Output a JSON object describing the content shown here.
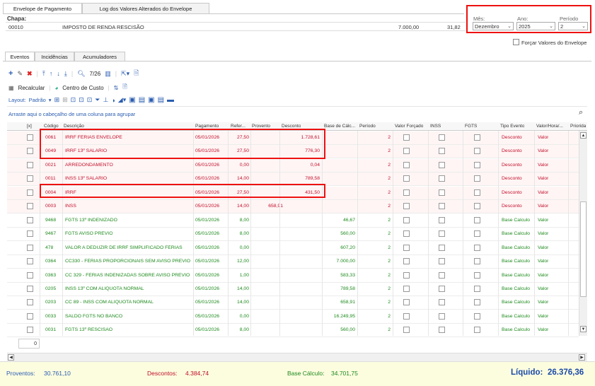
{
  "tabs": [
    "Envelope de Pagamento",
    "Log dos Valores Alterados do Envelope"
  ],
  "chapa": {
    "label": "Chapa:",
    "value": "00010",
    "desc": "IMPOSTO DE RENDA RESCISÃO",
    "num1": "7.000,00",
    "num2": "31,82"
  },
  "period": {
    "mes_label": "Mês:",
    "mes_value": "Dezembro",
    "ano_label": "Ano:",
    "ano_value": "2025",
    "periodo_label": "Período",
    "periodo_value": "2"
  },
  "forcar_label": "Forçar Valores do Envelope",
  "subtabs": [
    "Eventos",
    "Incidências",
    "Acumuladores"
  ],
  "toolbar": {
    "counter": "7/26",
    "recalcular": "Recalcular",
    "centro": "Centro de Custo",
    "layout": "Layout:",
    "padrao": "Padrão"
  },
  "group_hint": "Arraste aqui o cabeçalho de uma coluna para agrupar",
  "columns": [
    "[x]",
    "Código",
    "Descrição",
    "Pagamento",
    "Refer...",
    "Provento",
    "Desconto",
    "Base de Cálc...",
    "Período",
    "Valor Forçado",
    "INSS",
    "FGTS",
    "Tipo Evento",
    "Valor/Hora/...",
    "Priorida"
  ],
  "rows": [
    {
      "cod": "0061",
      "desc": "IRRF FÉRIAS ENVELOPE",
      "pag": "05/01/2026",
      "ref": "27,50",
      "prov": "",
      "desc_val": "1.728,61",
      "base": "",
      "per": "2",
      "tipo": "Desconto",
      "vh": "Valor",
      "kind": "red"
    },
    {
      "cod": "0049",
      "desc": "IRRF 13º SALARIO",
      "pag": "05/01/2026",
      "ref": "27,50",
      "prov": "",
      "desc_val": "776,30",
      "base": "",
      "per": "2",
      "tipo": "Desconto",
      "vh": "Valor",
      "kind": "red"
    },
    {
      "cod": "0021",
      "desc": "ARREDONDAMENTO",
      "pag": "05/01/2026",
      "ref": "0,00",
      "prov": "",
      "desc_val": "0,04",
      "base": "",
      "per": "2",
      "tipo": "Desconto",
      "vh": "Valor",
      "kind": "red"
    },
    {
      "cod": "0011",
      "desc": "INSS 13º SALARIO",
      "pag": "05/01/2026",
      "ref": "14,00",
      "prov": "",
      "desc_val": "789,58",
      "base": "",
      "per": "2",
      "tipo": "Desconto",
      "vh": "Valor",
      "kind": "red"
    },
    {
      "cod": "0004",
      "desc": "IRRF",
      "pag": "05/01/2026",
      "ref": "27,50",
      "prov": "",
      "desc_val": "431,50",
      "base": "",
      "per": "2",
      "tipo": "Desconto",
      "vh": "Valor",
      "kind": "red"
    },
    {
      "cod": "0003",
      "desc": "INSS",
      "pag": "05/01/2026",
      "ref": "14,00",
      "prov": "658,91",
      "desc_val": "",
      "base": "",
      "per": "2",
      "tipo": "Desconto",
      "vh": "Valor",
      "kind": "red"
    },
    {
      "cod": "9468",
      "desc": "FGTS 13º INDENIZADO",
      "pag": "05/01/2026",
      "ref": "8,00",
      "prov": "",
      "desc_val": "",
      "base": "46,67",
      "per": "2",
      "tipo": "Base Calculo",
      "vh": "Valor",
      "kind": "green"
    },
    {
      "cod": "9467",
      "desc": "FGTS AVISO PRÉVIO",
      "pag": "05/01/2026",
      "ref": "8,00",
      "prov": "",
      "desc_val": "",
      "base": "560,00",
      "per": "2",
      "tipo": "Base Calculo",
      "vh": "Valor",
      "kind": "green"
    },
    {
      "cod": "478",
      "desc": "VALOR A DEDUZIR DE IRRF SIMPLIFICADO FÉRIAS",
      "pag": "05/01/2026",
      "ref": "0,00",
      "prov": "",
      "desc_val": "",
      "base": "607,20",
      "per": "2",
      "tipo": "Base Calculo",
      "vh": "Valor",
      "kind": "green"
    },
    {
      "cod": "0364",
      "desc": "CC330 - FÉRIAS PROPORCIONAIS SEM AVISO PRÉVIO",
      "pag": "05/01/2026",
      "ref": "12,00",
      "prov": "",
      "desc_val": "",
      "base": "7.000,00",
      "per": "2",
      "tipo": "Base Calculo",
      "vh": "Valor",
      "kind": "green"
    },
    {
      "cod": "0363",
      "desc": "CC 329 - FÉRIAS INDENIZADAS SOBRE AVISO PRÉVIO",
      "pag": "05/01/2026",
      "ref": "1,00",
      "prov": "",
      "desc_val": "",
      "base": "583,33",
      "per": "2",
      "tipo": "Base Calculo",
      "vh": "Valor",
      "kind": "green"
    },
    {
      "cod": "0205",
      "desc": "INSS 13º COM ALIQUOTA NORMAL",
      "pag": "05/01/2026",
      "ref": "14,00",
      "prov": "",
      "desc_val": "",
      "base": "789,58",
      "per": "2",
      "tipo": "Base Calculo",
      "vh": "Valor",
      "kind": "green"
    },
    {
      "cod": "0203",
      "desc": "CC 89 - INSS COM ALIQUOTA NORMAL",
      "pag": "05/01/2026",
      "ref": "14,00",
      "prov": "",
      "desc_val": "",
      "base": "658,91",
      "per": "2",
      "tipo": "Base Calculo",
      "vh": "Valor",
      "kind": "green"
    },
    {
      "cod": "0033",
      "desc": "SALDO FGTS NO BANCO",
      "pag": "05/01/2026",
      "ref": "0,00",
      "prov": "",
      "desc_val": "",
      "base": "16.249,95",
      "per": "2",
      "tipo": "Base Calculo",
      "vh": "Valor",
      "kind": "green"
    },
    {
      "cod": "0031",
      "desc": "FGTS 13º RESCISAO",
      "pag": "05/01/2026",
      "ref": "8,00",
      "prov": "",
      "desc_val": "",
      "base": "560,00",
      "per": "2",
      "tipo": "Base Calculo",
      "vh": "Valor",
      "kind": "green"
    }
  ],
  "count_box": "0",
  "totals": {
    "proventos_label": "Proventos:",
    "proventos": "30.761,10",
    "descontos_label": "Descontos:",
    "descontos": "4.384,74",
    "base_label": "Base Cálculo:",
    "base": "34.701,75",
    "liquido_label": "Líquido:",
    "liquido": "26.376,36"
  },
  "colors": {
    "red": "#c0102a",
    "green": "#1d8a1d",
    "blue": "#2a5db0",
    "highlight": "#e11111"
  }
}
